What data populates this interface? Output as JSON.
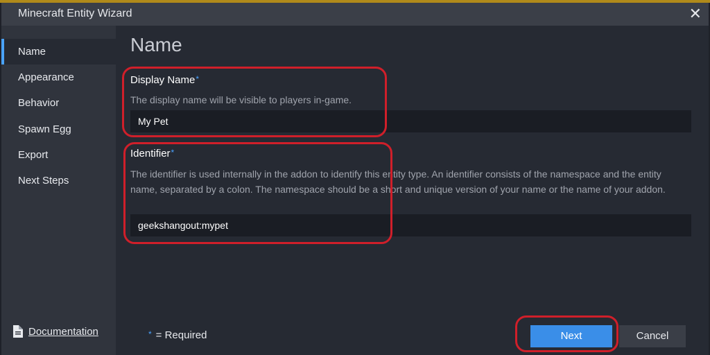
{
  "window": {
    "title": "Minecraft Entity Wizard",
    "close_glyph": "✕"
  },
  "sidebar": {
    "items": [
      {
        "label": "Name",
        "active": true
      },
      {
        "label": "Appearance"
      },
      {
        "label": "Behavior"
      },
      {
        "label": "Spawn Egg"
      },
      {
        "label": "Export"
      },
      {
        "label": "Next Steps"
      }
    ],
    "documentation_label": "Documentation",
    "documentation_icon": "document-icon"
  },
  "main": {
    "title": "Name",
    "display_name": {
      "label": "Display Name",
      "required_marker": "*",
      "description": "The display name will be visible to players in-game.",
      "value": "My Pet"
    },
    "identifier": {
      "label": "Identifier",
      "required_marker": "*",
      "description": "The identifier is used internally in the addon to identify this entity type. An identifier consists of the namespace and the entity name, separated by a colon. The namespace should be a short and unique version of your name or the name of your addon.",
      "value": "geekshangout:mypet"
    }
  },
  "footer": {
    "required_star": "*",
    "required_note": "= Required",
    "next_label": "Next",
    "cancel_label": "Cancel"
  },
  "colors": {
    "accent": "#3a8ee8",
    "highlight": "#d01f2a",
    "required": "#4aa3ff"
  }
}
